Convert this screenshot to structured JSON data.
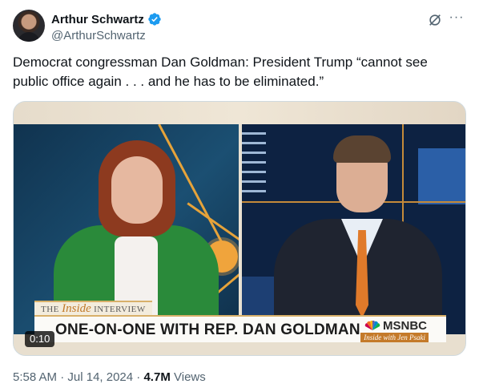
{
  "author": {
    "name": "Arthur Schwartz",
    "handle": "@ArthurSchwartz",
    "verified": true
  },
  "tweet": {
    "text": "Democrat congressman Dan Goldman: President Trump “cannot see public office again . . . and he has to be eliminated.”"
  },
  "video": {
    "timer": "0:10",
    "overlay": {
      "label_the": "THE",
      "label_inside": "Inside",
      "label_interview": "INTERVIEW",
      "title": "ONE-ON-ONE WITH REP. DAN GOLDMAN",
      "network": "MSNBC",
      "show": "Inside with Jen Psaki"
    }
  },
  "meta": {
    "time": "5:58 AM",
    "separator": "·",
    "date": "Jul 14, 2024",
    "views_count": "4.7M",
    "views_label": "Views"
  },
  "icons": {
    "verified": "verified-badge-icon",
    "grok": "grok-icon",
    "more": "more-icon"
  },
  "colors": {
    "verified": "#1d9bf0",
    "text": "#0f1419",
    "secondary": "#536471"
  }
}
